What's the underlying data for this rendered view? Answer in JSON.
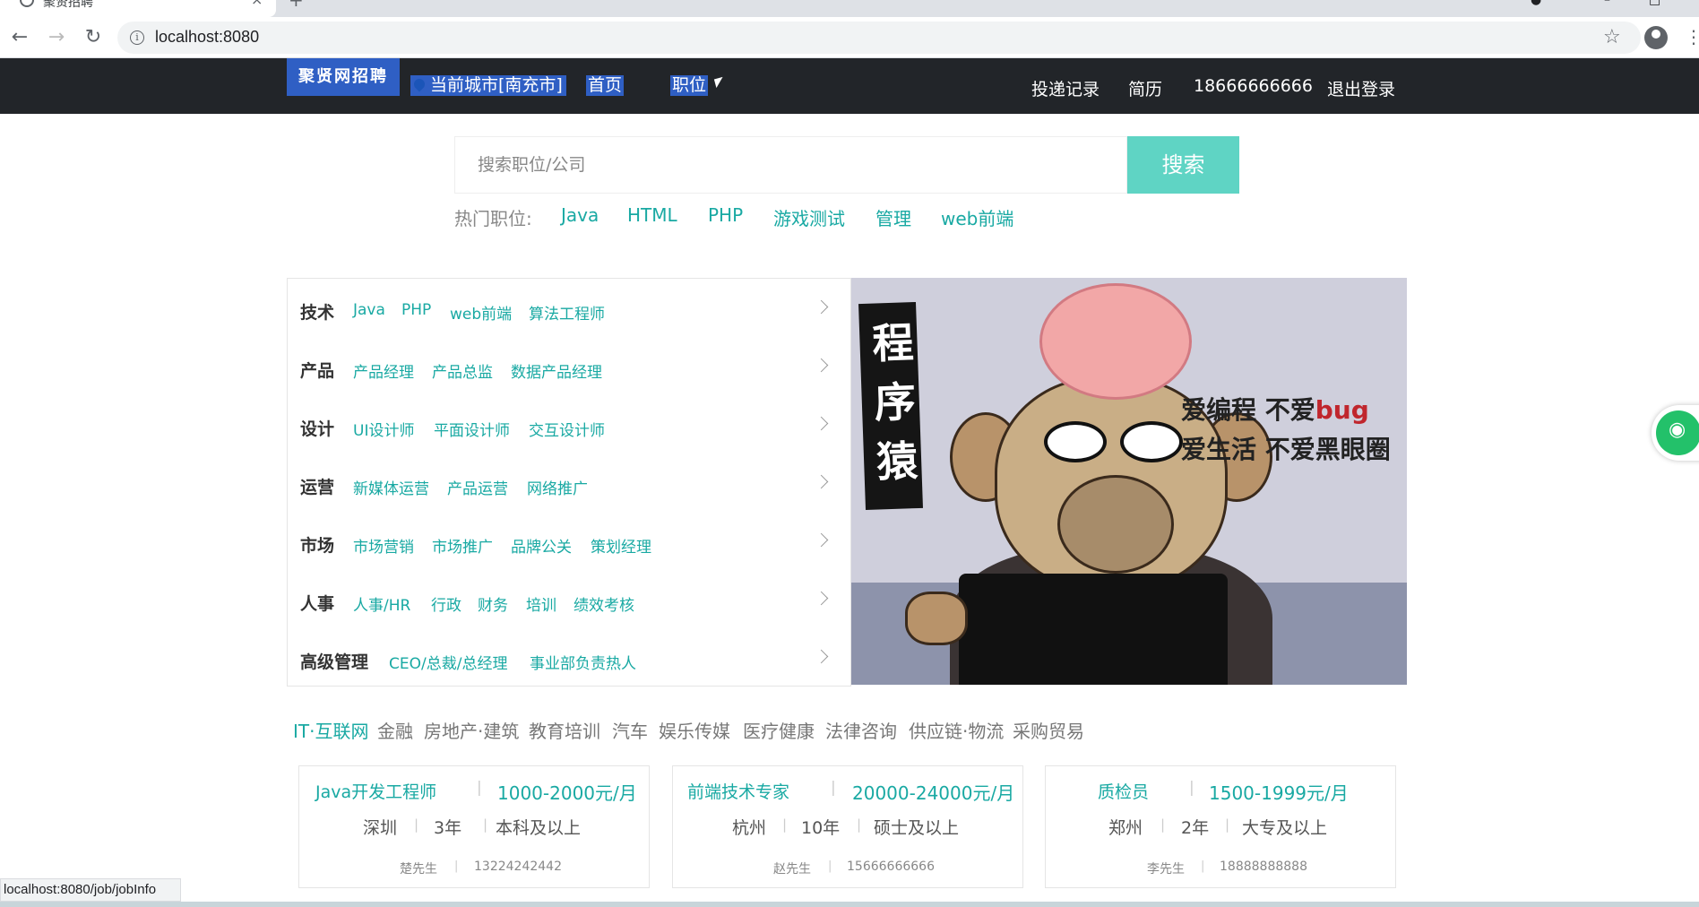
{
  "browser": {
    "tab_title": "聚贤招聘",
    "url": "localhost:8080",
    "status_url": "localhost:8080/job/jobInfo"
  },
  "nav": {
    "logo": "聚贤网招聘",
    "city": "当前城市[南充市]",
    "home": "首页",
    "jobs": "职位",
    "right": [
      "投递记录",
      "简历",
      "18666666666",
      "退出登录"
    ]
  },
  "search": {
    "placeholder": "搜索职位/公司",
    "button": "搜索",
    "hot_label": "热门职位:",
    "hot": [
      "Java",
      "HTML",
      "PHP",
      "游戏测试",
      "管理",
      "web前端"
    ]
  },
  "categories": [
    {
      "name": "技术",
      "items": [
        "Java",
        "PHP",
        "web前端",
        "算法工程师"
      ]
    },
    {
      "name": "产品",
      "items": [
        "产品经理",
        "产品总监",
        "数据产品经理"
      ]
    },
    {
      "name": "设计",
      "items": [
        "UI设计师",
        "平面设计师",
        "交互设计师"
      ]
    },
    {
      "name": "运营",
      "items": [
        "新媒体运营",
        "产品运营",
        "网络推广"
      ]
    },
    {
      "name": "市场",
      "items": [
        "市场营销",
        "市场推广",
        "品牌公关",
        "策划经理"
      ]
    },
    {
      "name": "人事",
      "items": [
        "人事/HR",
        "行政",
        "财务",
        "培训",
        "绩效考核"
      ]
    },
    {
      "name": "高级管理",
      "items": [
        "CEO/总裁/总经理",
        "事业部负责热人"
      ]
    }
  ],
  "banner": {
    "tag": "程序猿",
    "line1_a": "爱编程 不爱",
    "line1_b": "bug",
    "line2": "爱生活 不爱黑眼圈"
  },
  "industries": [
    "IT·互联网",
    "金融",
    "房地产·建筑",
    "教育培训",
    "汽车",
    "娱乐传媒",
    "医疗健康",
    "法律咨询",
    "供应链·物流",
    "采购贸易"
  ],
  "jobs": [
    {
      "title": "Java开发工程师",
      "salary": "1000-2000元/月",
      "city": "深圳",
      "years": "3年",
      "edu": "本科及以上",
      "contact": "楚先生",
      "phone": "13224242442"
    },
    {
      "title": "前端技术专家",
      "salary": "20000-24000元/月",
      "city": "杭州",
      "years": "10年",
      "edu": "硕士及以上",
      "contact": "赵先生",
      "phone": "15666666666"
    },
    {
      "title": "质检员",
      "salary": "1500-1999元/月",
      "city": "郑州",
      "years": "2年",
      "edu": "大专及以上",
      "contact": "李先生",
      "phone": "18888888888"
    }
  ]
}
